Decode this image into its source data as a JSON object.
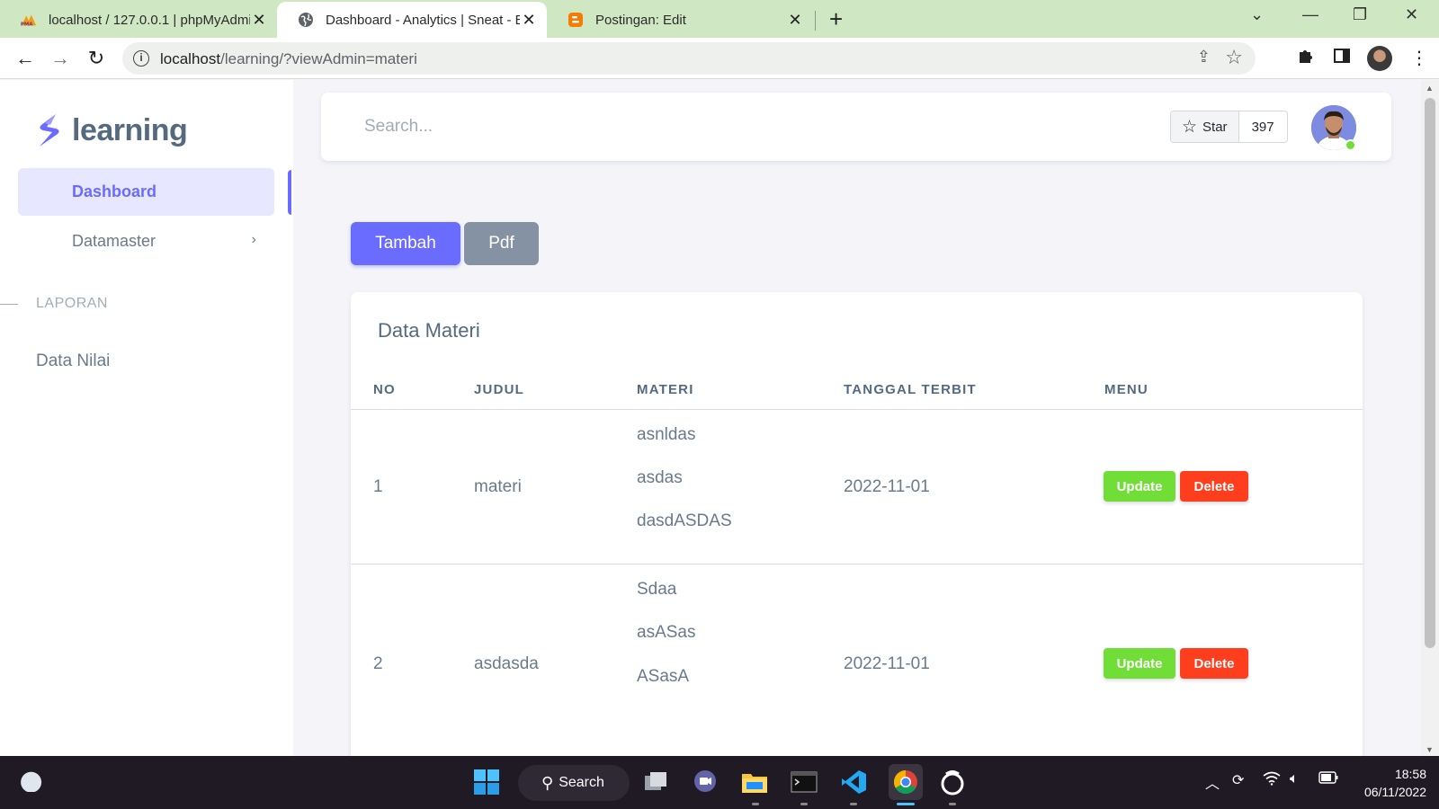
{
  "browser": {
    "tabs": [
      {
        "title": "localhost / 127.0.0.1 | phpMyAdmin"
      },
      {
        "title": "Dashboard - Analytics | Sneat - Bootstrap"
      },
      {
        "title": "Postingan: Edit"
      }
    ],
    "url_host": "localhost",
    "url_path": "/learning/?viewAdmin=materi"
  },
  "sidebar": {
    "brand": "learning",
    "items": [
      {
        "label": "Dashboard"
      },
      {
        "label": "Datamaster"
      }
    ],
    "section_header": "LAPORAN",
    "section_items": [
      {
        "label": "Data Nilai"
      }
    ]
  },
  "navbar": {
    "search_placeholder": "Search...",
    "star_label": "Star",
    "star_count": "397"
  },
  "actions": {
    "add_label": "Tambah",
    "pdf_label": "Pdf"
  },
  "table": {
    "title": "Data Materi",
    "columns": [
      "NO",
      "JUDUL",
      "MATERI",
      "TANGGAL TERBIT",
      "MENU"
    ],
    "rows": [
      {
        "no": "1",
        "judul": "materi",
        "materi": [
          "asnldas",
          "asdas",
          "dasdASDAS"
        ],
        "tanggal": "2022-11-01",
        "update": "Update",
        "delete": "Delete"
      },
      {
        "no": "2",
        "judul": "asdasda",
        "materi": [
          "Sdaa",
          "asASas",
          "ASasA"
        ],
        "tanggal": "2022-11-01",
        "update": "Update",
        "delete": "Delete"
      }
    ]
  },
  "taskbar": {
    "search_label": "Search",
    "time": "18:58",
    "date": "06/11/2022"
  },
  "colors": {
    "primary": "#696cff",
    "secondary": "#8592a3",
    "success": "#71dd37",
    "danger": "#ff3e1d",
    "tabbar": "#cfe8c3"
  }
}
